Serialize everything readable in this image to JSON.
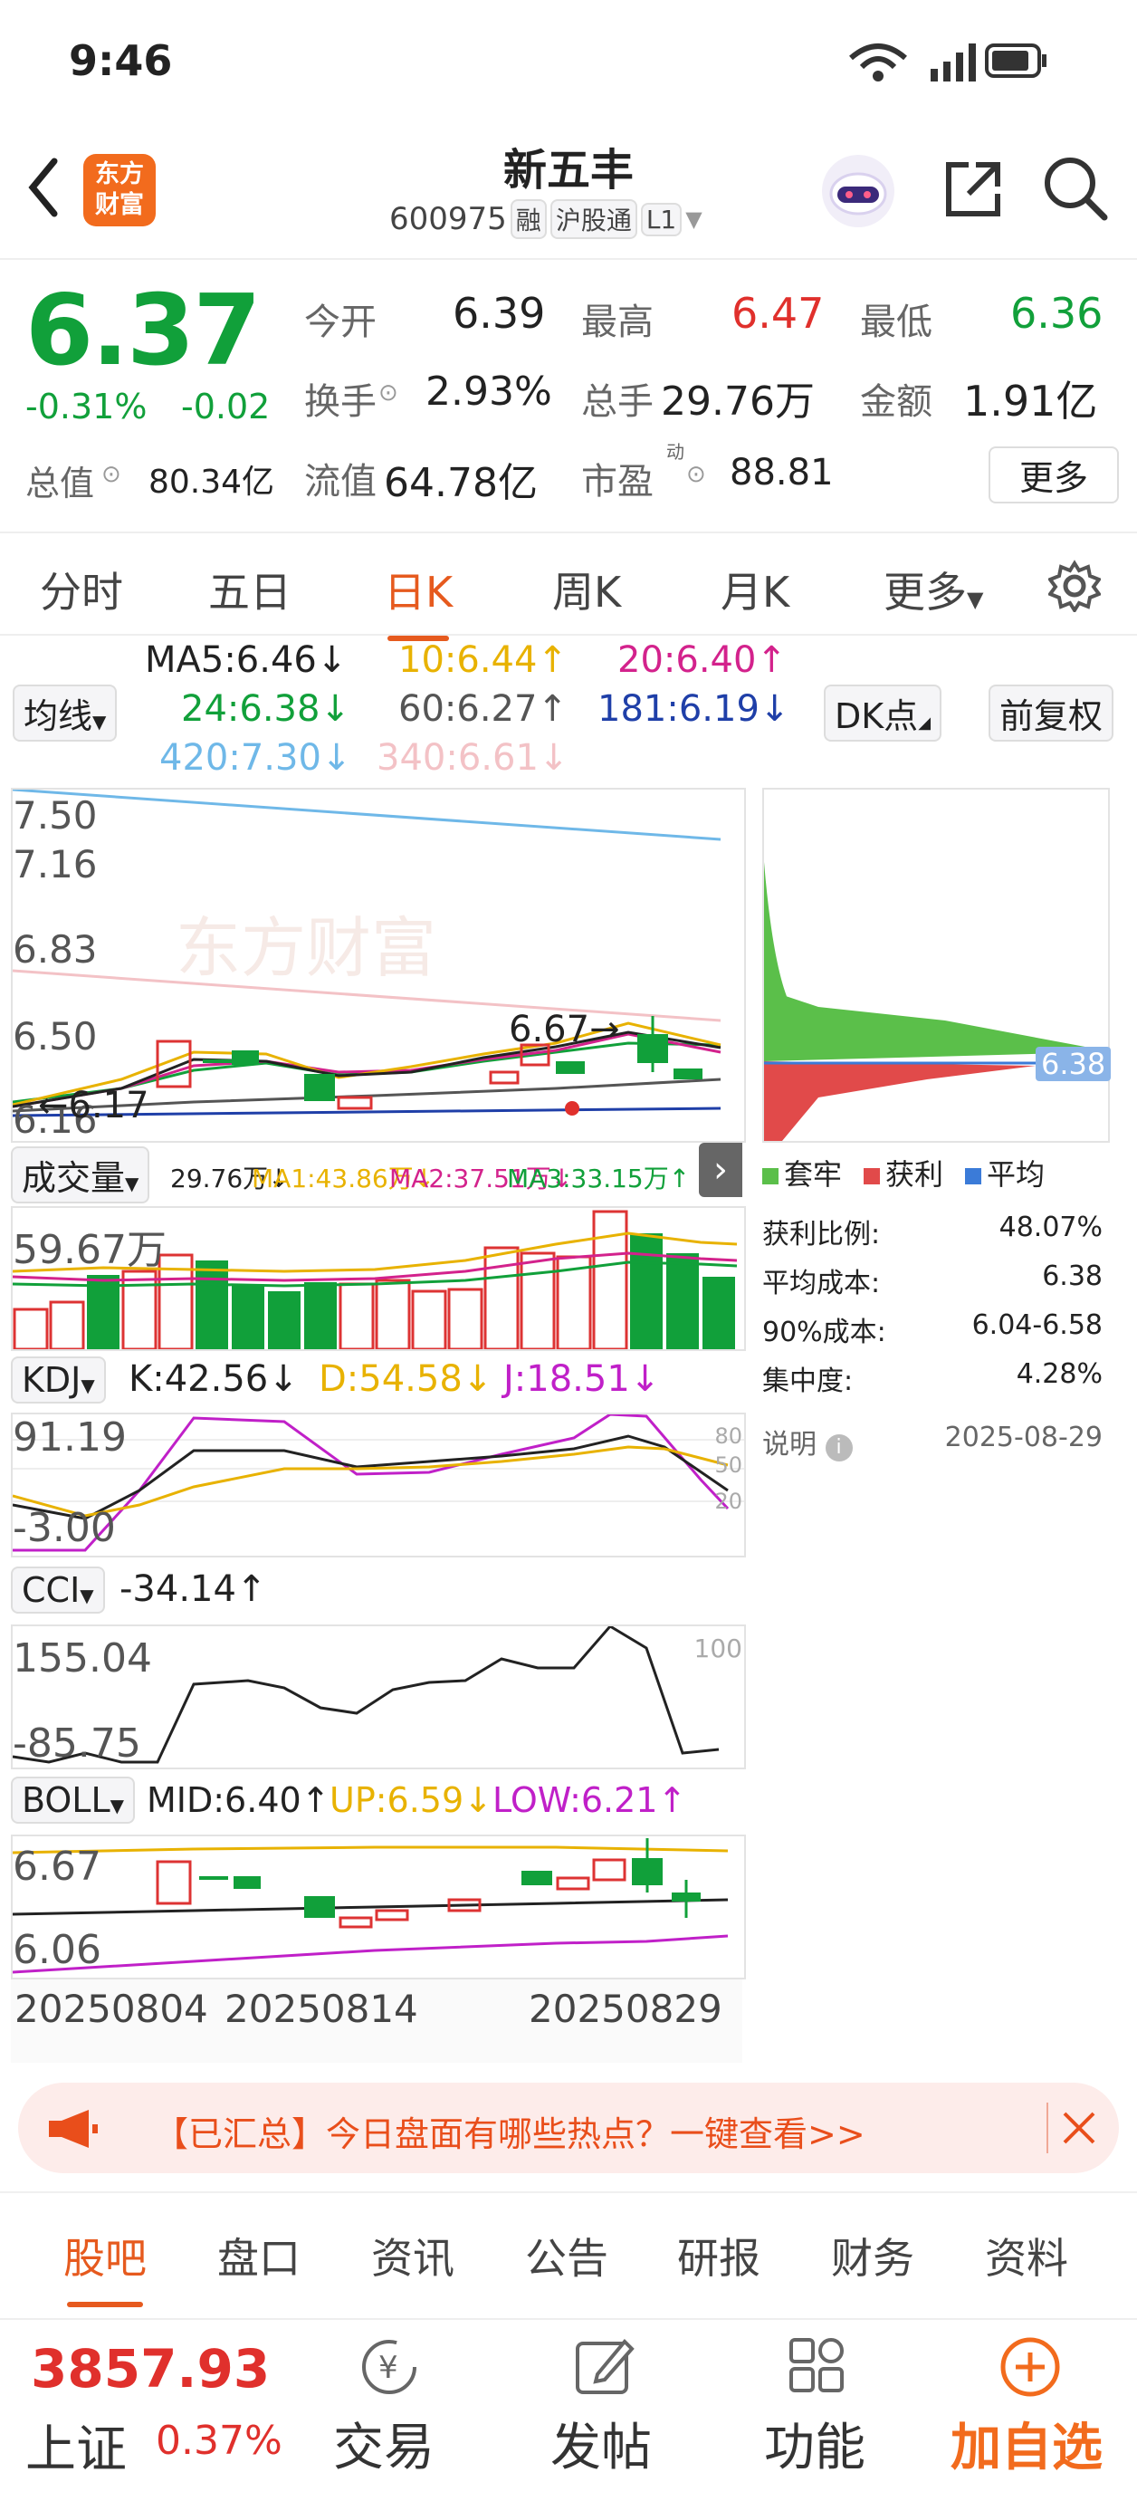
{
  "status": {
    "time": "9:46",
    "signal": "6"
  },
  "header": {
    "logo_line1": "东方",
    "logo_line2": "财富",
    "title": "新五丰",
    "code": "600975",
    "tags": [
      "融",
      "沪股通",
      "L1"
    ]
  },
  "quote": {
    "price": "6.37",
    "change_pct": "-0.31%",
    "change": "-0.02",
    "open_label": "今开",
    "open": "6.39",
    "high_label": "最高",
    "high": "6.47",
    "low_label": "最低",
    "low": "6.36",
    "turnover_label": "换手",
    "turnover": "2.93%",
    "volume_label": "总手",
    "volume": "29.76万",
    "amount_label": "金额",
    "amount": "1.91亿",
    "mktcap_label": "总值",
    "mktcap": "80.34亿",
    "float_label": "流值",
    "float": "64.78亿",
    "pe_label": "市盈",
    "pe_sup": "动",
    "pe": "88.81",
    "more": "更多"
  },
  "tabs": {
    "items": [
      "分时",
      "五日",
      "日K",
      "周K",
      "月K",
      "更多"
    ],
    "active": "日K"
  },
  "ma": {
    "selector": "均线",
    "ma5": "MA5:6.46↓",
    "ma10": "10:6.44↑",
    "ma20": "20:6.40↑",
    "ma24": "24:6.38↓",
    "ma60": "60:6.27↑",
    "ma181": "181:6.19↓",
    "ma420": "420:7.30↓",
    "ma340": "340:6.61↓",
    "dk": "DK点",
    "adjust": "前复权"
  },
  "kline": {
    "y_labels": [
      "7.50",
      "7.16",
      "6.83",
      "6.50",
      "6.16"
    ],
    "high_mark": "6.67",
    "low_mark": "6.17",
    "watermark": "东方财富"
  },
  "chips": {
    "price_tag": "6.38",
    "legend": [
      "套牢",
      "获利",
      "平均"
    ],
    "rows": [
      {
        "label": "获利比例:",
        "value": "48.07%"
      },
      {
        "label": "平均成本:",
        "value": "6.38"
      },
      {
        "label": "90%成本:",
        "value": "6.04-6.58"
      },
      {
        "label": "集中度:",
        "value": "4.28%"
      }
    ],
    "note": "说明",
    "date": "2025-08-29"
  },
  "volume": {
    "selector": "成交量",
    "vol": "29.76万↓",
    "ma1": "MA1:43.86万↓",
    "ma2": "MA2:37.51万↓",
    "ma3": "MA3:33.15万↑",
    "ylabel": "59.67万"
  },
  "kdj": {
    "selector": "KDJ",
    "k": "K:42.56↓",
    "d": "D:54.58↓",
    "j": "J:18.51↓",
    "ymax": "91.19",
    "ymin": "-3.00",
    "ticks": [
      "80",
      "50",
      "20"
    ]
  },
  "cci": {
    "selector": "CCI",
    "value": "-34.14↑",
    "ymax": "155.04",
    "ymin": "-85.75",
    "tick": "100"
  },
  "boll": {
    "selector": "BOLL",
    "mid": "MID:6.40↑",
    "up": "UP:6.59↓",
    "low": "LOW:6.21↑",
    "ymax": "6.67",
    "ymin": "6.06"
  },
  "dates": [
    "20250804",
    "20250814",
    "20250829"
  ],
  "banner": {
    "text": "【已汇总】今日盘面有哪些热点？一键查看>>"
  },
  "subtabs": {
    "items": [
      "股吧",
      "盘口",
      "资讯",
      "公告",
      "研报",
      "财务",
      "资料"
    ],
    "active": "股吧"
  },
  "bottom": {
    "index_value": "3857.93",
    "index_name": "上证",
    "index_pct": "0.37%",
    "trade": "交易",
    "post": "发帖",
    "func": "功能",
    "add": "加自选"
  }
}
